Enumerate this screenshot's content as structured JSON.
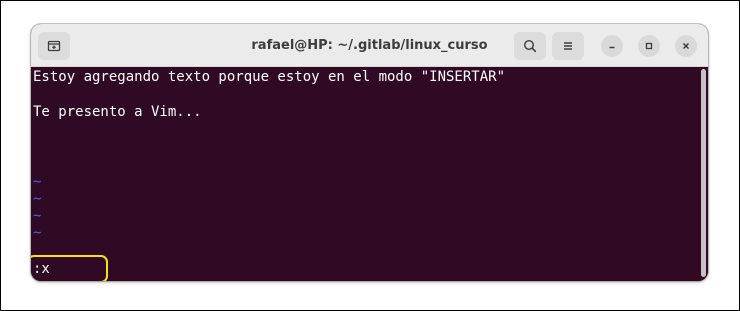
{
  "window": {
    "title": "rafael@HP: ~/.gitlab/linux_curso"
  },
  "titlebar": {
    "new_tab_icon": "new-tab-icon",
    "search_icon": "search-icon",
    "menu_icon": "hamburger-menu-icon",
    "minimize_icon": "minimize-icon",
    "maximize_icon": "maximize-icon",
    "close_icon": "close-icon"
  },
  "terminal": {
    "lines": [
      "Estoy agregando texto porque estoy en el modo \"INSERTAR\"",
      "Te presento a Vim..."
    ],
    "tildes": [
      "~",
      "~",
      "~",
      "~"
    ],
    "command": ":x"
  },
  "colors": {
    "terminal_bg": "#300a24",
    "titlebar_bg": "#ebebeb",
    "tilde": "#5b5bd6",
    "highlight": "#f0e419"
  }
}
